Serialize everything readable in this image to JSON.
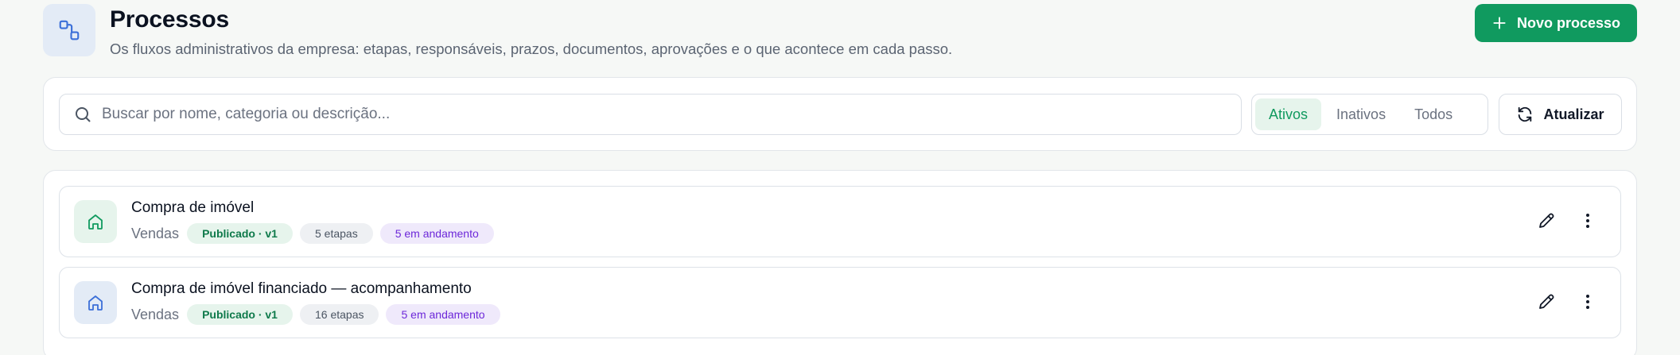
{
  "header": {
    "icon": "workflow-icon",
    "title": "Processos",
    "subtitle": "Os fluxos administrativos da empresa: etapas, responsáveis, prazos, documentos, aprovações e o que acontece em cada passo.",
    "new_button": {
      "icon": "plus-icon",
      "label": "Novo processo"
    }
  },
  "toolbar": {
    "search": {
      "icon": "search-icon",
      "placeholder": "Buscar por nome, categoria ou descrição...",
      "value": ""
    },
    "filters": [
      {
        "label": "Ativos",
        "active": true
      },
      {
        "label": "Inativos",
        "active": false
      },
      {
        "label": "Todos",
        "active": false
      }
    ],
    "refresh": {
      "icon": "refresh-icon",
      "label": "Atualizar"
    }
  },
  "processes": [
    {
      "icon": "home-icon",
      "title": "Compra de imóvel",
      "category": "Vendas",
      "status": "Publicado · v1",
      "steps": "5 etapas",
      "in_progress": "5 em andamento"
    },
    {
      "icon": "home-icon",
      "title": "Compra de imóvel financiado — acompanhamento",
      "category": "Vendas",
      "status": "Publicado · v1",
      "steps": "16 etapas",
      "in_progress": "5 em andamento"
    }
  ],
  "colors": {
    "accent": "#109a5f",
    "accent_soft": "#e6f4ec",
    "info_soft": "#e3ebf6",
    "info": "#3b6fd8",
    "purple": "#6d28d9",
    "purple_soft": "#efe9fb"
  }
}
